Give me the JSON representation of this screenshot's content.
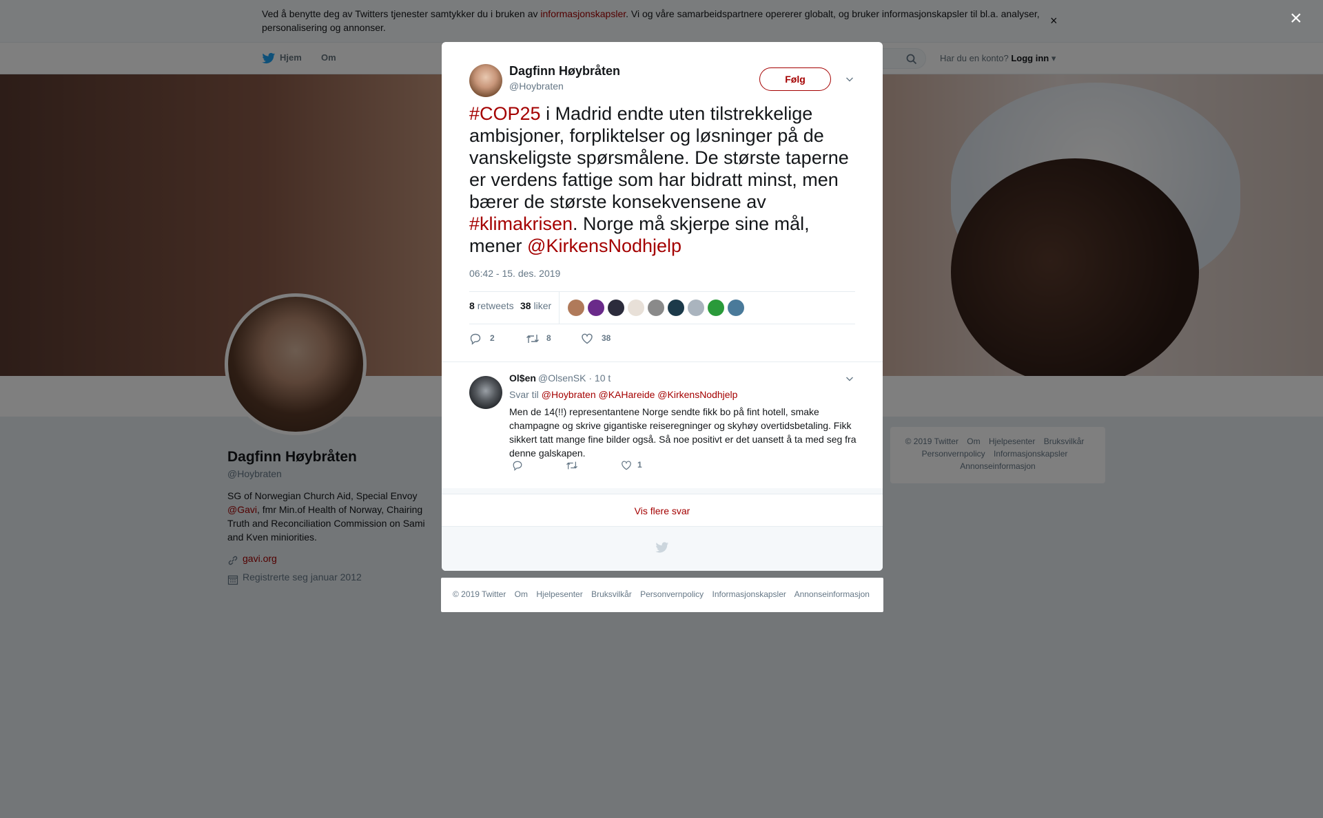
{
  "cookie_banner": {
    "text_before": "Ved å benytte deg av Twitters tjenester samtykker du i bruken av ",
    "link": "informasjonskapsler",
    "text_after": ". Vi og våre samarbeidspartnere opererer globalt, og bruker informasjonskapsler til bl.a. analyser, personalisering og annonser.",
    "close": "×"
  },
  "topnav": {
    "home": "Hjem",
    "about": "Om",
    "account_prompt": "Har du en konto?",
    "login": "Logg inn"
  },
  "profile": {
    "name": "Dagfinn Høybråten",
    "handle": "@Hoybraten",
    "bio_1": "SG of Norwegian Church Aid, Special Envoy",
    "bio_mention": "@Gavi",
    "bio_2": ", fmr Min.of Health of Norway, Chairing Truth and Reconciliation Commission on Sami and Kven miniorities.",
    "website": "gavi.org",
    "joined": "Registrerte seg januar 2012"
  },
  "right_footer": [
    "© 2019 Twitter",
    "Om",
    "Hjelpesenter",
    "Bruksvilkår",
    "Personvernpolicy",
    "Informasjonskapsler",
    "Annonseinformasjon"
  ],
  "overlay_close": "×",
  "tweet": {
    "name": "Dagfinn Høybråten",
    "handle": "@Hoybraten",
    "follow": "Følg",
    "text_tag1": "#COP25",
    "text_1": " i Madrid endte uten tilstrekkelige ambisjoner, forpliktelser og løsninger på de vanskeligste spørsmålene. De største taperne er verdens fattige som har bidratt minst, men bærer de største konsekvensene av ",
    "text_tag2": "#klimakrisen",
    "text_2": ". Norge må skjerpe sine mål, mener ",
    "text_mention": "@KirkensNodhjelp",
    "time": "06:42 - 15. des. 2019",
    "retweets_count": "8",
    "retweets_label": "retweets",
    "likes_count": "38",
    "likes_label": "liker",
    "reply_count": "2",
    "retweet_action_count": "8",
    "like_action_count": "38"
  },
  "liker_colors": [
    "#b07a5a",
    "#6a2a8a",
    "#2c2c3c",
    "#e8e0d8",
    "#8a8a8a",
    "#1c3a4a",
    "#aab4be",
    "#2a9a3a",
    "#4a7a9a"
  ],
  "reply": {
    "name": "Ol$en",
    "handle": "@OlsenSK · 10 t",
    "reply_to_label": "Svar til",
    "reply_to_mentions": "@Hoybraten @KAHareide @KirkensNodhjelp",
    "text": "Men de 14(!!) representantene Norge sendte fikk bo på fint hotell, smake champagne og skrive gigantiske reiseregninger og skyhøy overtidsbetaling. Fikk sikkert tatt mange fine bilder også. Så noe positivt er det uansett å ta med seg fra denne galskapen.",
    "like_count": "1"
  },
  "more_replies": "Vis flere svar",
  "modal_footer": [
    "© 2019 Twitter",
    "Om",
    "Hjelpesenter",
    "Bruksvilkår",
    "Personvernpolicy",
    "Informasjonskapsler",
    "Annonseinformasjon"
  ],
  "colors": {
    "accent": "#a40000",
    "muted": "#657786",
    "twitter_blue": "#1da1f2"
  }
}
